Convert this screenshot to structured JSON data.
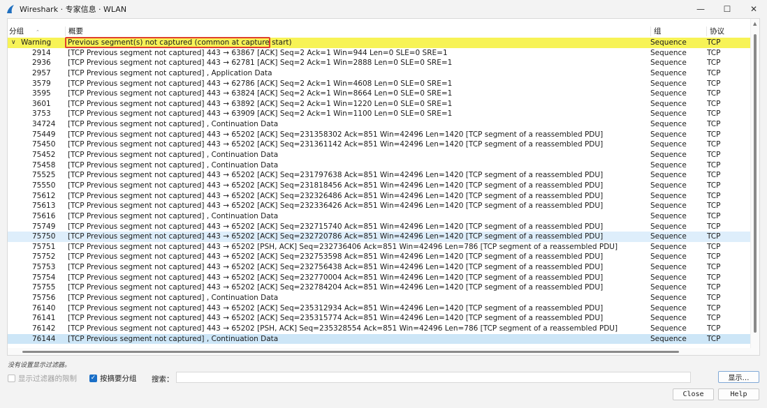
{
  "window": {
    "title": "Wireshark · 专家信息 · WLAN",
    "controls": {
      "minimize": "—",
      "maximize": "☐",
      "close": "✕"
    }
  },
  "columns": {
    "group": "分组",
    "summary": "概要",
    "grp": "组",
    "protocol": "协议"
  },
  "warning_row": {
    "label": "Warning",
    "summary": "Previous segment(s) not captured (common at capture start)",
    "group": "Sequence",
    "protocol": "TCP"
  },
  "rows": [
    {
      "packet": "2914",
      "summary": "[TCP Previous segment not captured] 443 → 63867 [ACK] Seq=2 Ack=1 Win=944 Len=0 SLE=0 SRE=1",
      "group": "Sequence",
      "protocol": "TCP"
    },
    {
      "packet": "2936",
      "summary": "[TCP Previous segment not captured] 443 → 62781 [ACK] Seq=2 Ack=1 Win=2888 Len=0 SLE=0 SRE=1",
      "group": "Sequence",
      "protocol": "TCP"
    },
    {
      "packet": "2957",
      "summary": "[TCP Previous segment not captured] , Application Data",
      "group": "Sequence",
      "protocol": "TCP"
    },
    {
      "packet": "3579",
      "summary": "[TCP Previous segment not captured] 443 → 62786 [ACK] Seq=2 Ack=1 Win=4608 Len=0 SLE=0 SRE=1",
      "group": "Sequence",
      "protocol": "TCP"
    },
    {
      "packet": "3595",
      "summary": "[TCP Previous segment not captured] 443 → 63824 [ACK] Seq=2 Ack=1 Win=8664 Len=0 SLE=0 SRE=1",
      "group": "Sequence",
      "protocol": "TCP"
    },
    {
      "packet": "3601",
      "summary": "[TCP Previous segment not captured] 443 → 63892 [ACK] Seq=2 Ack=1 Win=1220 Len=0 SLE=0 SRE=1",
      "group": "Sequence",
      "protocol": "TCP"
    },
    {
      "packet": "3753",
      "summary": "[TCP Previous segment not captured] 443 → 63909 [ACK] Seq=2 Ack=1 Win=1100 Len=0 SLE=0 SRE=1",
      "group": "Sequence",
      "protocol": "TCP"
    },
    {
      "packet": "34724",
      "summary": "[TCP Previous segment not captured] , Continuation Data",
      "group": "Sequence",
      "protocol": "TCP"
    },
    {
      "packet": "75449",
      "summary": "[TCP Previous segment not captured] 443 → 65202 [ACK] Seq=231358302 Ack=851 Win=42496 Len=1420 [TCP segment of a reassembled PDU]",
      "group": "Sequence",
      "protocol": "TCP"
    },
    {
      "packet": "75450",
      "summary": "[TCP Previous segment not captured] 443 → 65202 [ACK] Seq=231361142 Ack=851 Win=42496 Len=1420 [TCP segment of a reassembled PDU]",
      "group": "Sequence",
      "protocol": "TCP"
    },
    {
      "packet": "75452",
      "summary": "[TCP Previous segment not captured] , Continuation Data",
      "group": "Sequence",
      "protocol": "TCP"
    },
    {
      "packet": "75458",
      "summary": "[TCP Previous segment not captured] , Continuation Data",
      "group": "Sequence",
      "protocol": "TCP"
    },
    {
      "packet": "75525",
      "summary": "[TCP Previous segment not captured] 443 → 65202 [ACK] Seq=231797638 Ack=851 Win=42496 Len=1420 [TCP segment of a reassembled PDU]",
      "group": "Sequence",
      "protocol": "TCP"
    },
    {
      "packet": "75550",
      "summary": "[TCP Previous segment not captured] 443 → 65202 [ACK] Seq=231818456 Ack=851 Win=42496 Len=1420 [TCP segment of a reassembled PDU]",
      "group": "Sequence",
      "protocol": "TCP"
    },
    {
      "packet": "75612",
      "summary": "[TCP Previous segment not captured] 443 → 65202 [ACK] Seq=232326486 Ack=851 Win=42496 Len=1420 [TCP segment of a reassembled PDU]",
      "group": "Sequence",
      "protocol": "TCP"
    },
    {
      "packet": "75613",
      "summary": "[TCP Previous segment not captured] 443 → 65202 [ACK] Seq=232336426 Ack=851 Win=42496 Len=1420 [TCP segment of a reassembled PDU]",
      "group": "Sequence",
      "protocol": "TCP"
    },
    {
      "packet": "75616",
      "summary": "[TCP Previous segment not captured] , Continuation Data",
      "group": "Sequence",
      "protocol": "TCP"
    },
    {
      "packet": "75749",
      "summary": "[TCP Previous segment not captured] 443 → 65202 [ACK] Seq=232715740 Ack=851 Win=42496 Len=1420 [TCP segment of a reassembled PDU]",
      "group": "Sequence",
      "protocol": "TCP"
    },
    {
      "packet": "75750",
      "summary": "[TCP Previous segment not captured] 443 → 65202 [ACK] Seq=232720786 Ack=851 Win=42496 Len=1420 [TCP segment of a reassembled PDU]",
      "group": "Sequence",
      "protocol": "TCP",
      "highlight": "light"
    },
    {
      "packet": "75751",
      "summary": "[TCP Previous segment not captured] 443 → 65202 [PSH, ACK] Seq=232736406 Ack=851 Win=42496 Len=786 [TCP segment of a reassembled PDU]",
      "group": "Sequence",
      "protocol": "TCP"
    },
    {
      "packet": "75752",
      "summary": "[TCP Previous segment not captured] 443 → 65202 [ACK] Seq=232753598 Ack=851 Win=42496 Len=1420 [TCP segment of a reassembled PDU]",
      "group": "Sequence",
      "protocol": "TCP"
    },
    {
      "packet": "75753",
      "summary": "[TCP Previous segment not captured] 443 → 65202 [ACK] Seq=232756438 Ack=851 Win=42496 Len=1420 [TCP segment of a reassembled PDU]",
      "group": "Sequence",
      "protocol": "TCP"
    },
    {
      "packet": "75754",
      "summary": "[TCP Previous segment not captured] 443 → 65202 [ACK] Seq=232770004 Ack=851 Win=42496 Len=1420 [TCP segment of a reassembled PDU]",
      "group": "Sequence",
      "protocol": "TCP"
    },
    {
      "packet": "75755",
      "summary": "[TCP Previous segment not captured] 443 → 65202 [ACK] Seq=232784204 Ack=851 Win=42496 Len=1420 [TCP segment of a reassembled PDU]",
      "group": "Sequence",
      "protocol": "TCP"
    },
    {
      "packet": "75756",
      "summary": "[TCP Previous segment not captured] , Continuation Data",
      "group": "Sequence",
      "protocol": "TCP"
    },
    {
      "packet": "76140",
      "summary": "[TCP Previous segment not captured] 443 → 65202 [ACK] Seq=235312934 Ack=851 Win=42496 Len=1420 [TCP segment of a reassembled PDU]",
      "group": "Sequence",
      "protocol": "TCP"
    },
    {
      "packet": "76141",
      "summary": "[TCP Previous segment not captured] 443 → 65202 [ACK] Seq=235315774 Ack=851 Win=42496 Len=1420 [TCP segment of a reassembled PDU]",
      "group": "Sequence",
      "protocol": "TCP"
    },
    {
      "packet": "76142",
      "summary": "[TCP Previous segment not captured] 443 → 65202 [PSH, ACK] Seq=235328554 Ack=851 Win=42496 Len=786 [TCP segment of a reassembled PDU]",
      "group": "Sequence",
      "protocol": "TCP"
    },
    {
      "packet": "76144",
      "summary": "[TCP Previous segment not captured] , Continuation Data",
      "group": "Sequence",
      "protocol": "TCP",
      "highlight": "selected"
    }
  ],
  "footer": {
    "status_note": "没有设置显示过滤器。",
    "limit_filter_label": "显示过滤器的限制",
    "group_by_summary_label": "按摘要分组",
    "search_label": "搜索：",
    "search_value": "",
    "show_button": "显示…",
    "close_button": "Close",
    "help_button": "Help"
  },
  "colors": {
    "warning": "#f7f356",
    "highlight_box": "#e0402d",
    "selected": "#cde6f7",
    "accent": "#1a6fc7"
  }
}
